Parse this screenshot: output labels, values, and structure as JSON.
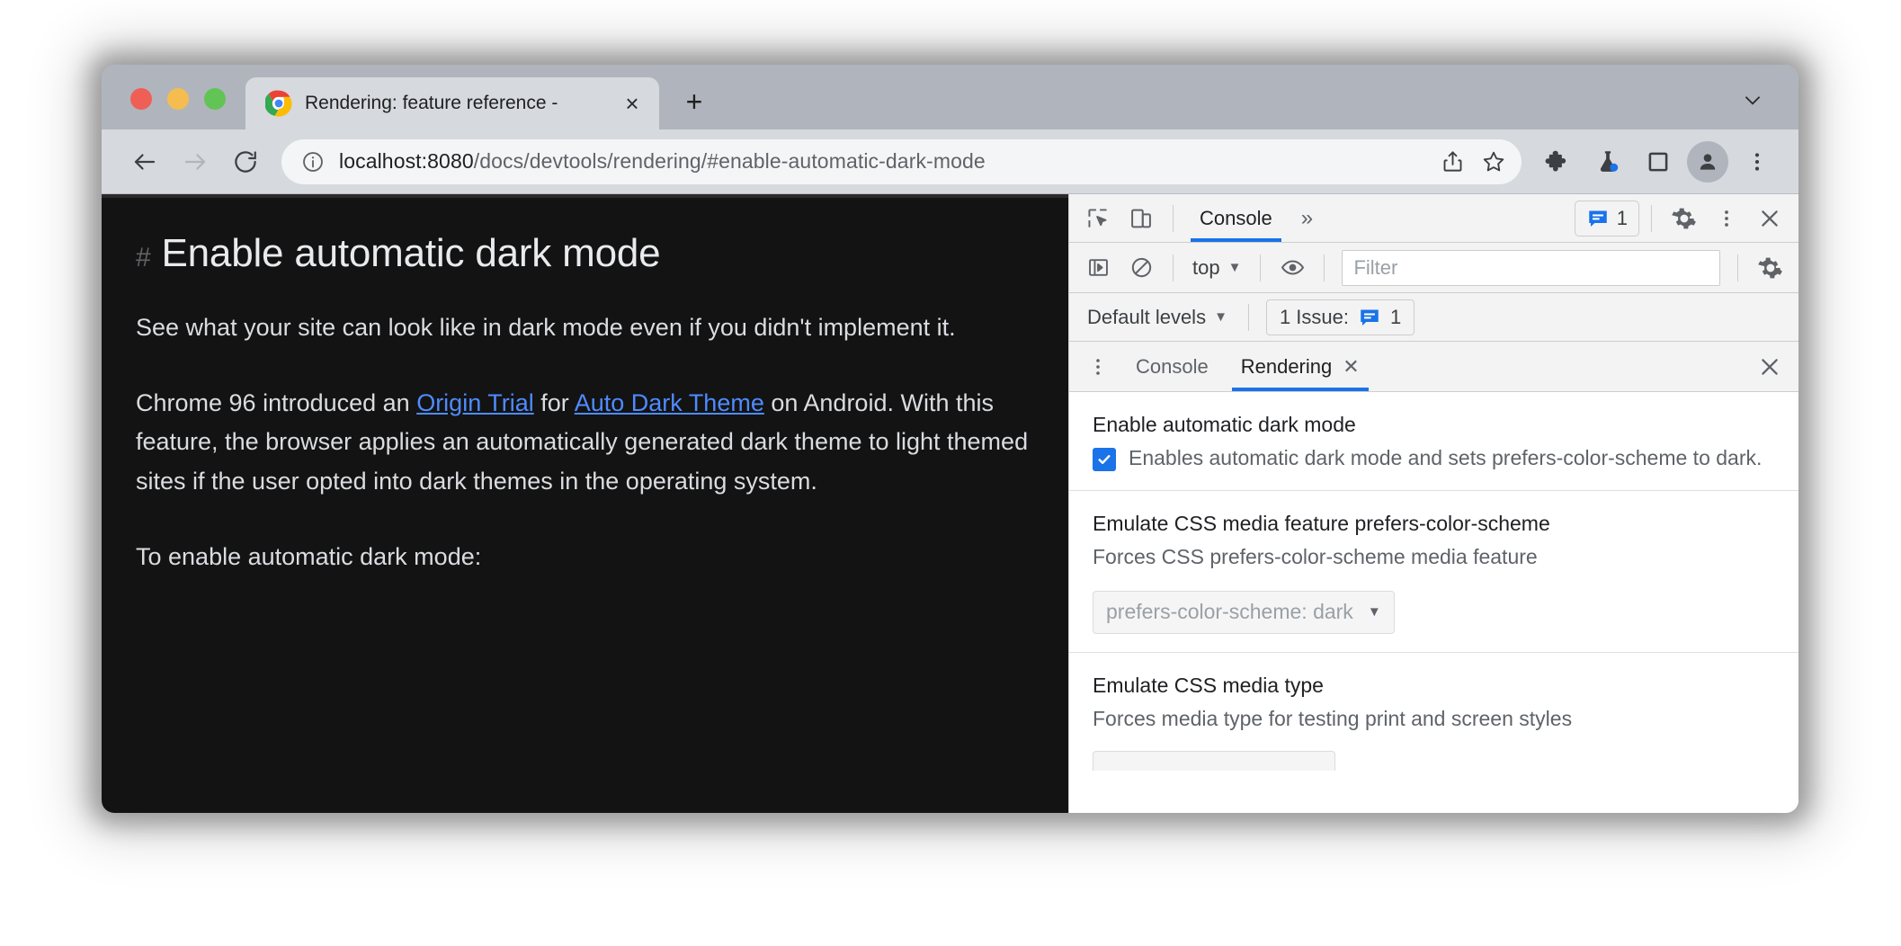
{
  "browser": {
    "tab": {
      "title": "Rendering: feature reference -",
      "favicon": "chrome-logo-icon",
      "close_label": "×"
    },
    "new_tab_label": "+",
    "toolbar": {
      "back": "back-arrow",
      "forward": "forward-arrow",
      "reload": "reload",
      "url_prefix": "localhost:8080",
      "url_path": "/docs/devtools/rendering/#enable-automatic-dark-mode",
      "url_full": "localhost:8080/docs/devtools/rendering/#enable-automatic-dark-mode",
      "share": "share-icon",
      "bookmark": "star-icon",
      "extensions": "puzzle-icon",
      "experiments": "flask-icon",
      "side_panel": "side-panel-icon",
      "profile": "avatar-icon",
      "menu": "three-dot-icon"
    }
  },
  "page": {
    "heading": "Enable automatic dark mode",
    "anchor": "#",
    "paragraph1": "See what your site can look like in dark mode even if you didn't implement it.",
    "paragraph2": {
      "part1": "Chrome 96 introduced an ",
      "link1": "Origin Trial",
      "part2": " for ",
      "link2": "Auto Dark Theme",
      "part3": " on Android. With this feature, the browser applies an automatically generated dark theme to light themed sites if the user opted into dark themes in the operating system."
    },
    "paragraph3": "To enable automatic dark mode:"
  },
  "devtools": {
    "main_toolbar": {
      "inspect": "inspect-icon",
      "device_toggle": "device-toolbar-icon",
      "tabs": [
        {
          "label": "Console",
          "active": true
        }
      ],
      "more_tabs": "»",
      "issues_count": "1",
      "settings": "gear-icon",
      "more": "three-dot-icon",
      "close": "close-icon"
    },
    "console_toolbar": {
      "sidebar_toggle": "console-sidebar-icon",
      "clear": "clear-console-icon",
      "context": "top",
      "eye": "live-expression-icon",
      "filter_placeholder": "Filter",
      "filter_value": "",
      "settings": "gear-icon"
    },
    "levels_bar": {
      "levels": "Default levels",
      "issues_text": "1 Issue:",
      "issues_count": "1"
    },
    "drawer": {
      "menu": "three-dot-icon",
      "tabs": [
        {
          "label": "Console",
          "active": false,
          "closable": false
        },
        {
          "label": "Rendering",
          "active": true,
          "closable": true
        }
      ],
      "close": "close-icon"
    },
    "rendering": [
      {
        "title": "Enable automatic dark mode",
        "desc": "Enables automatic dark mode and sets prefers-color-scheme to dark.",
        "checked": true
      },
      {
        "title": "Emulate CSS media feature prefers-color-scheme",
        "desc": "Forces CSS prefers-color-scheme media feature",
        "select_value": "prefers-color-scheme: dark"
      },
      {
        "title": "Emulate CSS media type",
        "desc": "Forces media type for testing print and screen styles"
      }
    ]
  },
  "colors": {
    "accent": "#1a73e8",
    "link": "#4f8bff",
    "page_bg": "#131313",
    "devtools_bg": "#ffffff",
    "chrome_frame": "#b0b5bd"
  }
}
